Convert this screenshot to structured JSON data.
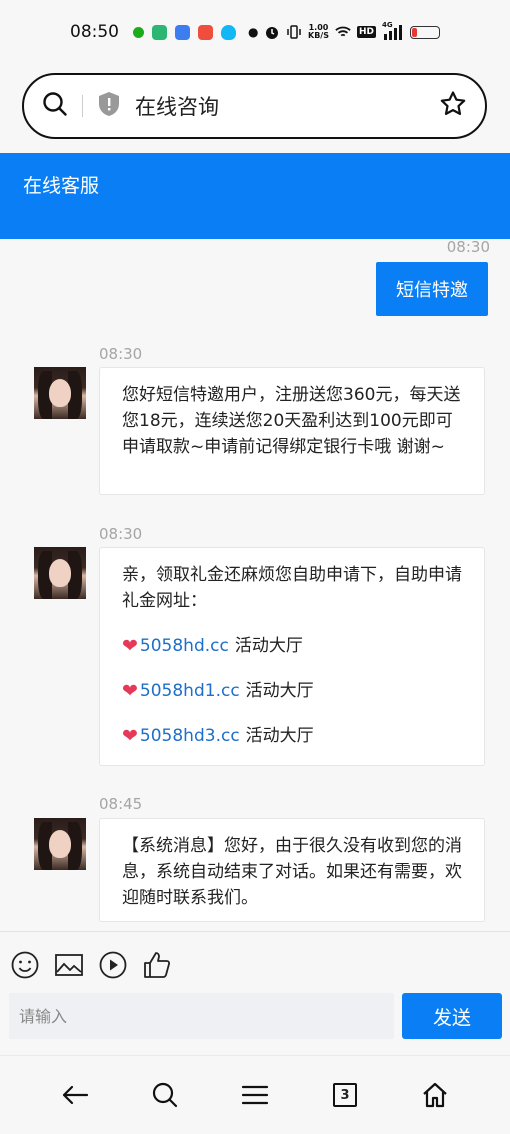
{
  "status_bar": {
    "time": "08:50",
    "net_speed_top": "1.00",
    "net_speed_bottom": "KB/S",
    "hd_badge": "HD",
    "signal": "4G"
  },
  "search": {
    "text": "在线咨询"
  },
  "header": {
    "title": "在线客服"
  },
  "messages": {
    "sent_time": "08:30",
    "sent_text": "短信特邀",
    "msg1_time": "08:30",
    "msg1_text": "您好短信特邀用户，注册送您360元，每天送您18元，连续送您20天盈利达到100元即可申请取款~申请前记得绑定银行卡哦 谢谢~",
    "msg2_time": "08:30",
    "msg2_intro": "亲，领取礼金还麻烦您自助申请下，自助申请礼金网址：",
    "links": [
      {
        "url": "5058hd.cc",
        "label": "活动大厅"
      },
      {
        "url": "5058hd1.cc",
        "label": "活动大厅"
      },
      {
        "url": "5058hd3.cc",
        "label": "活动大厅"
      }
    ],
    "msg3_time": "08:45",
    "msg3_text": "【系统消息】您好，由于很久没有收到您的消息，系统自动结束了对话。如果还有需要，欢迎随时联系我们。"
  },
  "composer": {
    "placeholder": "请输入",
    "send_label": "发送"
  },
  "navbar": {
    "tab_count": "3"
  },
  "colors": {
    "brand_blue": "#0a7ff5",
    "link_blue": "#1d6fc9",
    "heart_pink": "#e53958"
  },
  "icons": [
    "search-icon",
    "shield-icon",
    "star-icon",
    "smiley-icon",
    "image-icon",
    "video-icon",
    "thumbs-up-icon",
    "back-arrow-icon",
    "menu-icon",
    "home-icon"
  ]
}
